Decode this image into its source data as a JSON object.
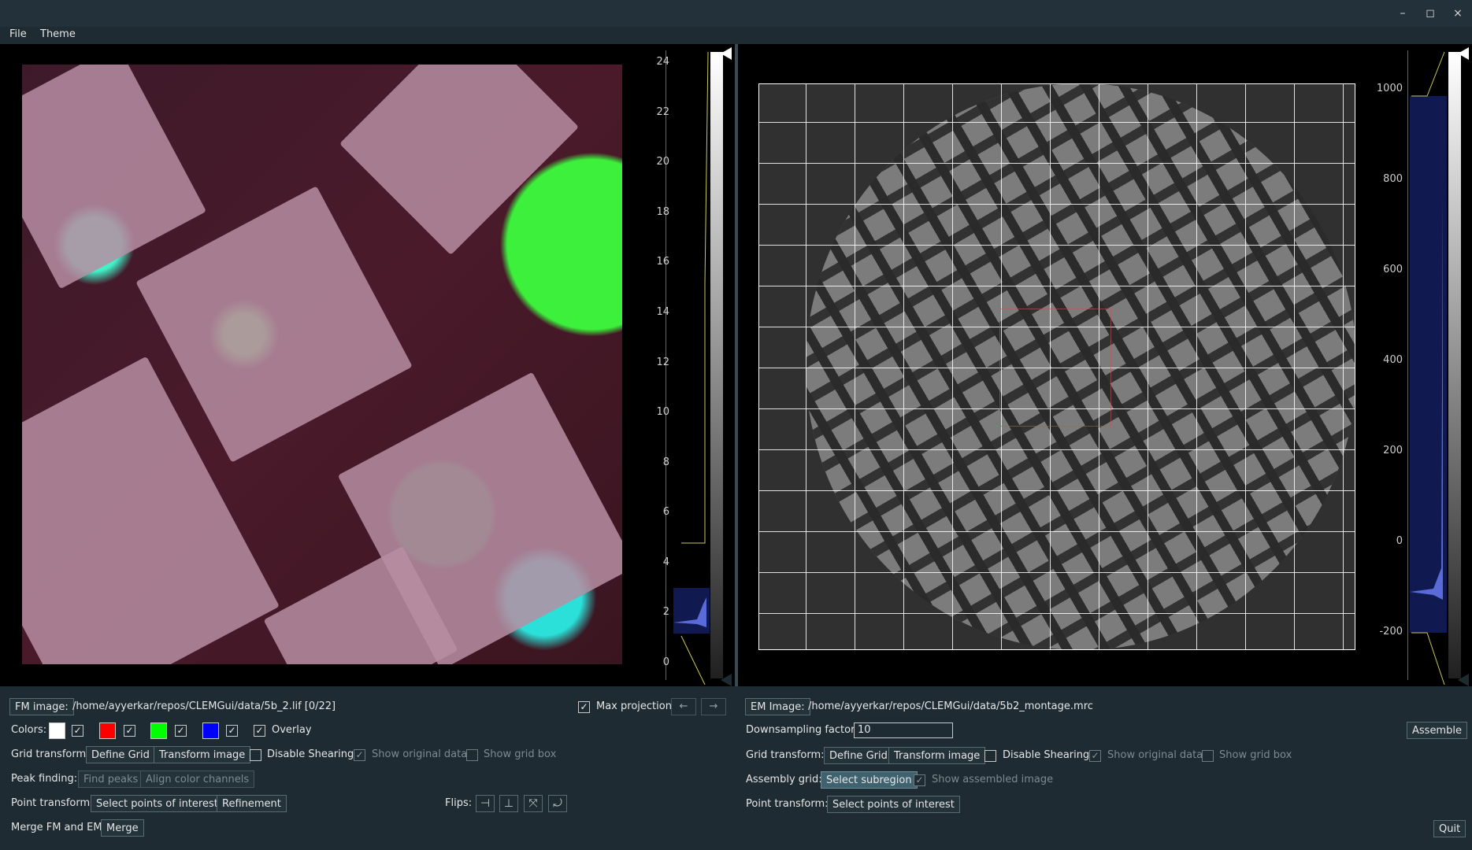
{
  "window": {
    "minimize": "–",
    "maximize": "◻",
    "close": "×"
  },
  "menu": {
    "file": "File",
    "theme": "Theme"
  },
  "fm": {
    "axis_ticks": [
      "24",
      "22",
      "20",
      "18",
      "16",
      "14",
      "12",
      "10",
      "8",
      "6",
      "4",
      "2",
      "0"
    ],
    "image_button": "FM image:",
    "path": "/home/ayyerkar/repos/CLEMGui/data/5b_2.lif [0/22]",
    "max_projection": "Max projection",
    "prev": "←",
    "next": "→",
    "colors_label": "Colors:",
    "swatches": [
      "#ffffff",
      "#ff0000",
      "#00ff00",
      "#0000ff"
    ],
    "overlay": "Overlay",
    "grid_transform_label": "Grid transform:",
    "define_grid": "Define Grid",
    "transform_image": "Transform image",
    "disable_shearing": "Disable Shearing",
    "show_original": "Show original data",
    "show_grid_box": "Show grid box",
    "peak_finding_label": "Peak finding:",
    "find_peaks": "Find peaks",
    "align_color": "Align color channels",
    "point_transform_label": "Point transform:",
    "select_poi": "Select points of interest",
    "refinement": "Refinement",
    "flips_label": "Flips:",
    "merge_label": "Merge FM and EM:",
    "merge": "Merge"
  },
  "em": {
    "axis_ticks": [
      "1000",
      "800",
      "600",
      "400",
      "200",
      "0",
      "-200"
    ],
    "image_button": "EM Image:",
    "path": "/home/ayyerkar/repos/CLEMGui/data/5b2_montage.mrc",
    "downsampling_label": "Downsampling factor:",
    "downsampling_value": "10",
    "assemble": "Assemble",
    "grid_transform_label": "Grid transform:",
    "define_grid": "Define Grid",
    "transform_image": "Transform image",
    "disable_shearing": "Disable Shearing",
    "show_original": "Show original data",
    "show_grid_box": "Show grid box",
    "assembly_grid_label": "Assembly grid:",
    "select_subregion": "Select subregion",
    "show_assembled": "Show assembled image",
    "point_transform_label": "Point transform:",
    "select_poi": "Select points of interest",
    "quit": "Quit"
  }
}
